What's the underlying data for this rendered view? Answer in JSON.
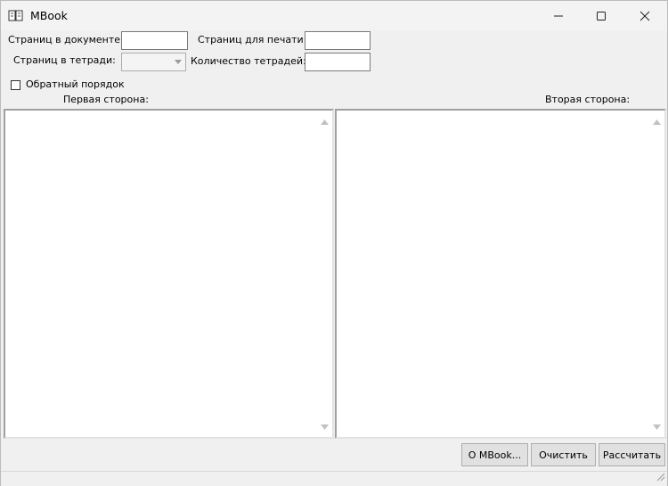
{
  "window": {
    "title": "MBook"
  },
  "form": {
    "pages_in_document_label": "Страниц в документе:",
    "pages_in_document_value": "",
    "pages_to_print_label": "Страниц для печати:",
    "pages_to_print_value": "",
    "pages_in_notebook_label": "Страниц в тетради:",
    "pages_in_notebook_value": "",
    "notebook_count_label": "Количество тетрадей:",
    "notebook_count_value": "",
    "reverse_order_label": "Обратный порядок",
    "reverse_order_checked": false
  },
  "panels": {
    "first_side_label": "Первая сторона:",
    "second_side_label": "Вторая сторона:",
    "first_side_text": "",
    "second_side_text": ""
  },
  "buttons": {
    "about": "О MBook...",
    "clear": "Очистить",
    "calculate": "Рассчитать"
  },
  "icons": {
    "app": "book-icon",
    "minimize": "minimize-icon",
    "maximize": "maximize-icon",
    "close": "close-icon"
  }
}
